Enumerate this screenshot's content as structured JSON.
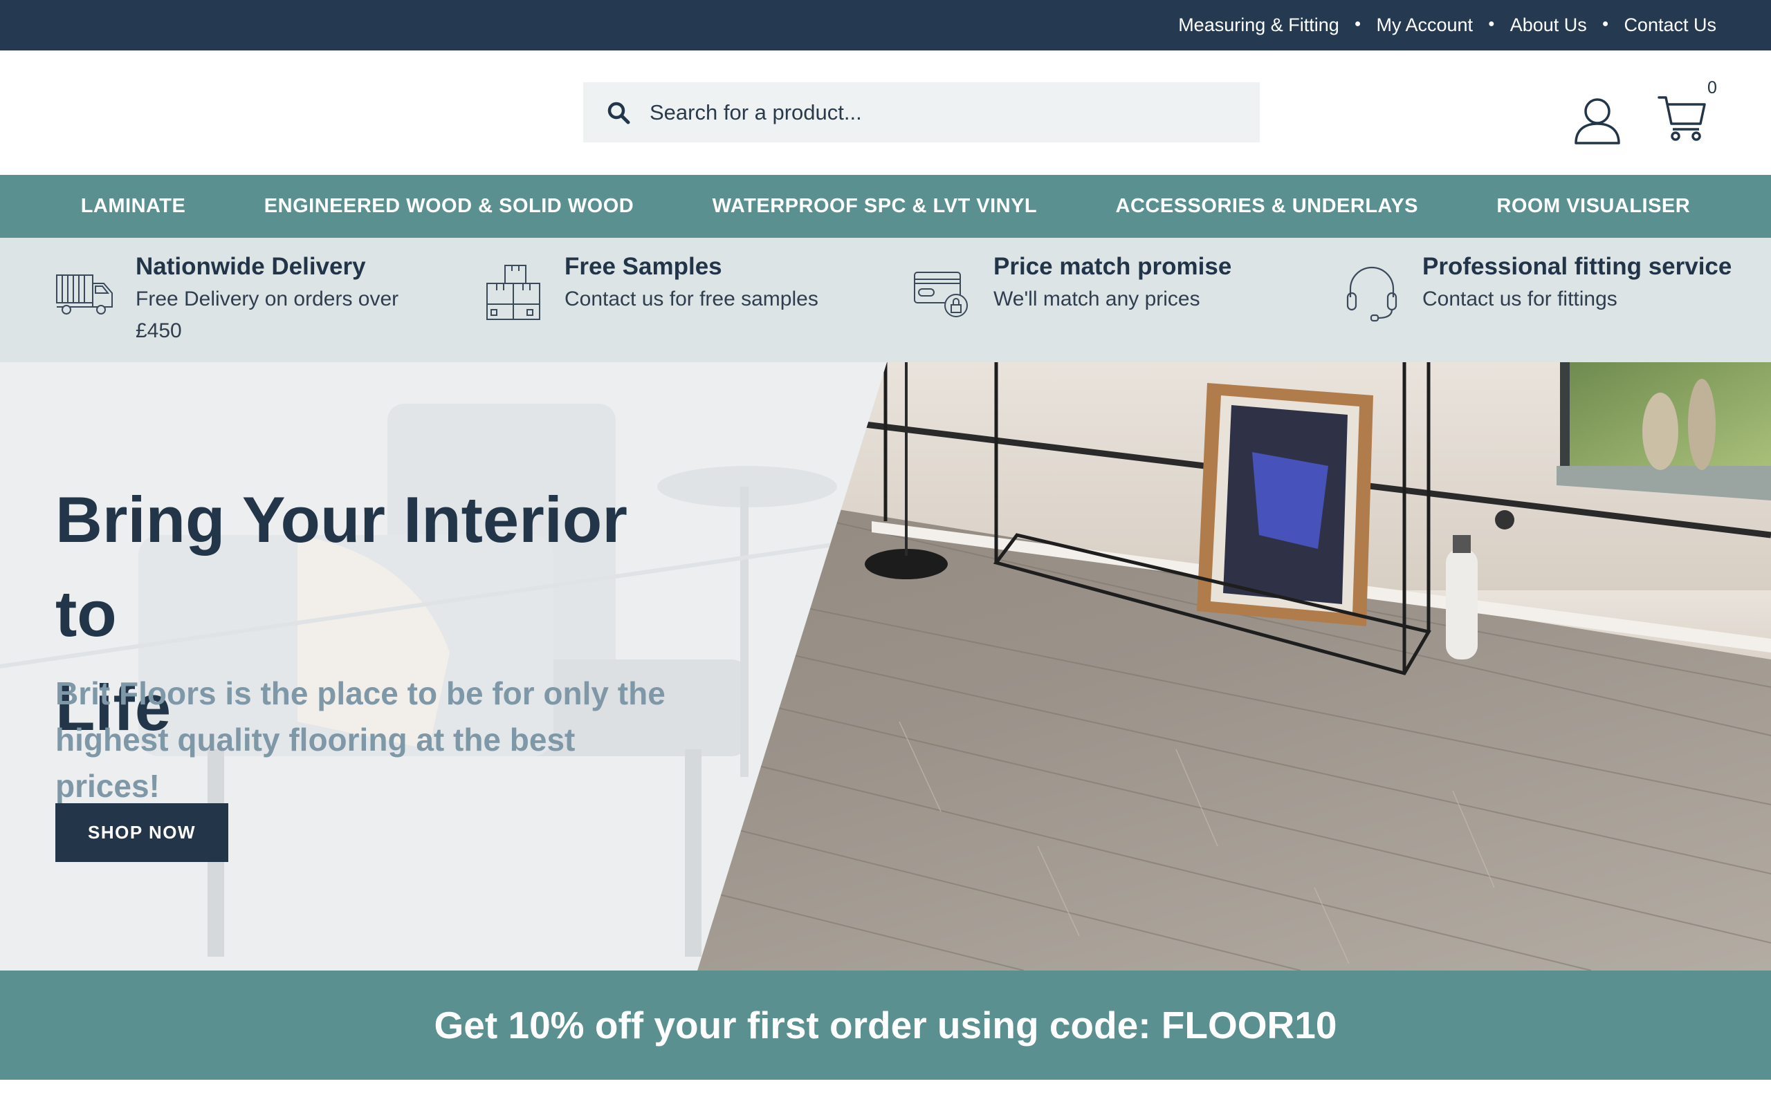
{
  "topbar": {
    "links": [
      "Measuring & Fitting",
      "My Account",
      "About Us",
      "Contact Us"
    ]
  },
  "header": {
    "search_placeholder": "Search for a product...",
    "cart_count": "0"
  },
  "categories": [
    "LAMINATE",
    "ENGINEERED WOOD & SOLID WOOD",
    "WATERPROOF SPC & LVT VINYL",
    "ACCESSORIES & UNDERLAYS",
    "ROOM VISUALISER"
  ],
  "features": [
    {
      "title": "Nationwide Delivery",
      "line1": "Free Delivery on orders over",
      "line2": "£450",
      "icon": "delivery-truck-icon"
    },
    {
      "title": "Free Samples",
      "line1": "Contact us for free samples",
      "line2": "",
      "icon": "boxes-icon"
    },
    {
      "title": "Price match promise",
      "line1": "We'll match any prices",
      "line2": "",
      "icon": "card-payment-icon"
    },
    {
      "title": "Professional fitting service",
      "line1": "Contact us for fittings",
      "line2": "",
      "icon": "headset-icon"
    }
  ],
  "hero": {
    "heading_line1": "Bring Your Interior to",
    "heading_line2": "Life",
    "subheading_line1": "Brit Floors is the place to be for only the",
    "subheading_line2": "highest quality flooring at the best prices!",
    "cta": "SHOP NOW"
  },
  "promo": {
    "text": "Get 10% off your first order using code: FLOOR10"
  },
  "colors": {
    "navy": "#253a50",
    "teal": "#5a9190",
    "strip": "#dde4e6",
    "muted_text": "#7f98a7"
  }
}
